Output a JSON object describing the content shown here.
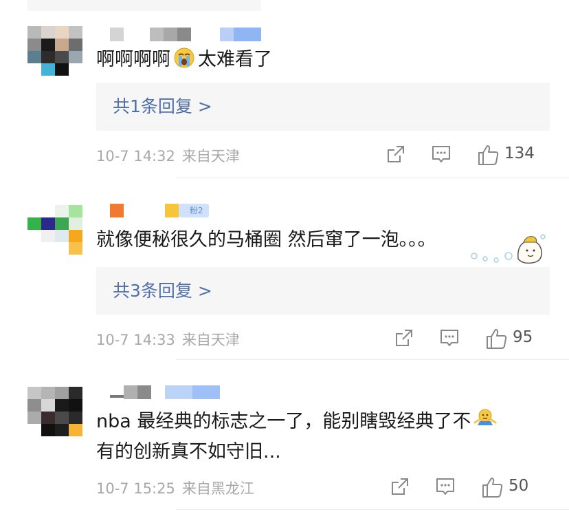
{
  "comments": [
    {
      "text_before": "啊啊啊啊",
      "emoji": "crying-face-icon",
      "text_after": "太难看了",
      "replies": "共1条回复 >",
      "time": "10-7 14:32",
      "location": "来自天津",
      "likes": "134"
    },
    {
      "badge": "粉2",
      "text": "就像便秘很久的马桶圈 然后窜了一泡。。。",
      "sticker": "cartoon-sticker-icon",
      "replies": "共3条回复 >",
      "time": "10-7 14:33",
      "location": "来自天津",
      "likes": "95"
    },
    {
      "line1": "nba 最经典的标志之一了，能别瞎毁经典了不",
      "emoji": "shrug-emoji-icon",
      "line2": "有的创新真不如守旧...",
      "time": "10-7 15:25",
      "location": "来自黑龙江",
      "likes": "50"
    }
  ],
  "colors": {
    "reply_link": "#4f6fa9",
    "meta_text": "#a8a8a8",
    "reply_bg": "#f6f6f6"
  }
}
